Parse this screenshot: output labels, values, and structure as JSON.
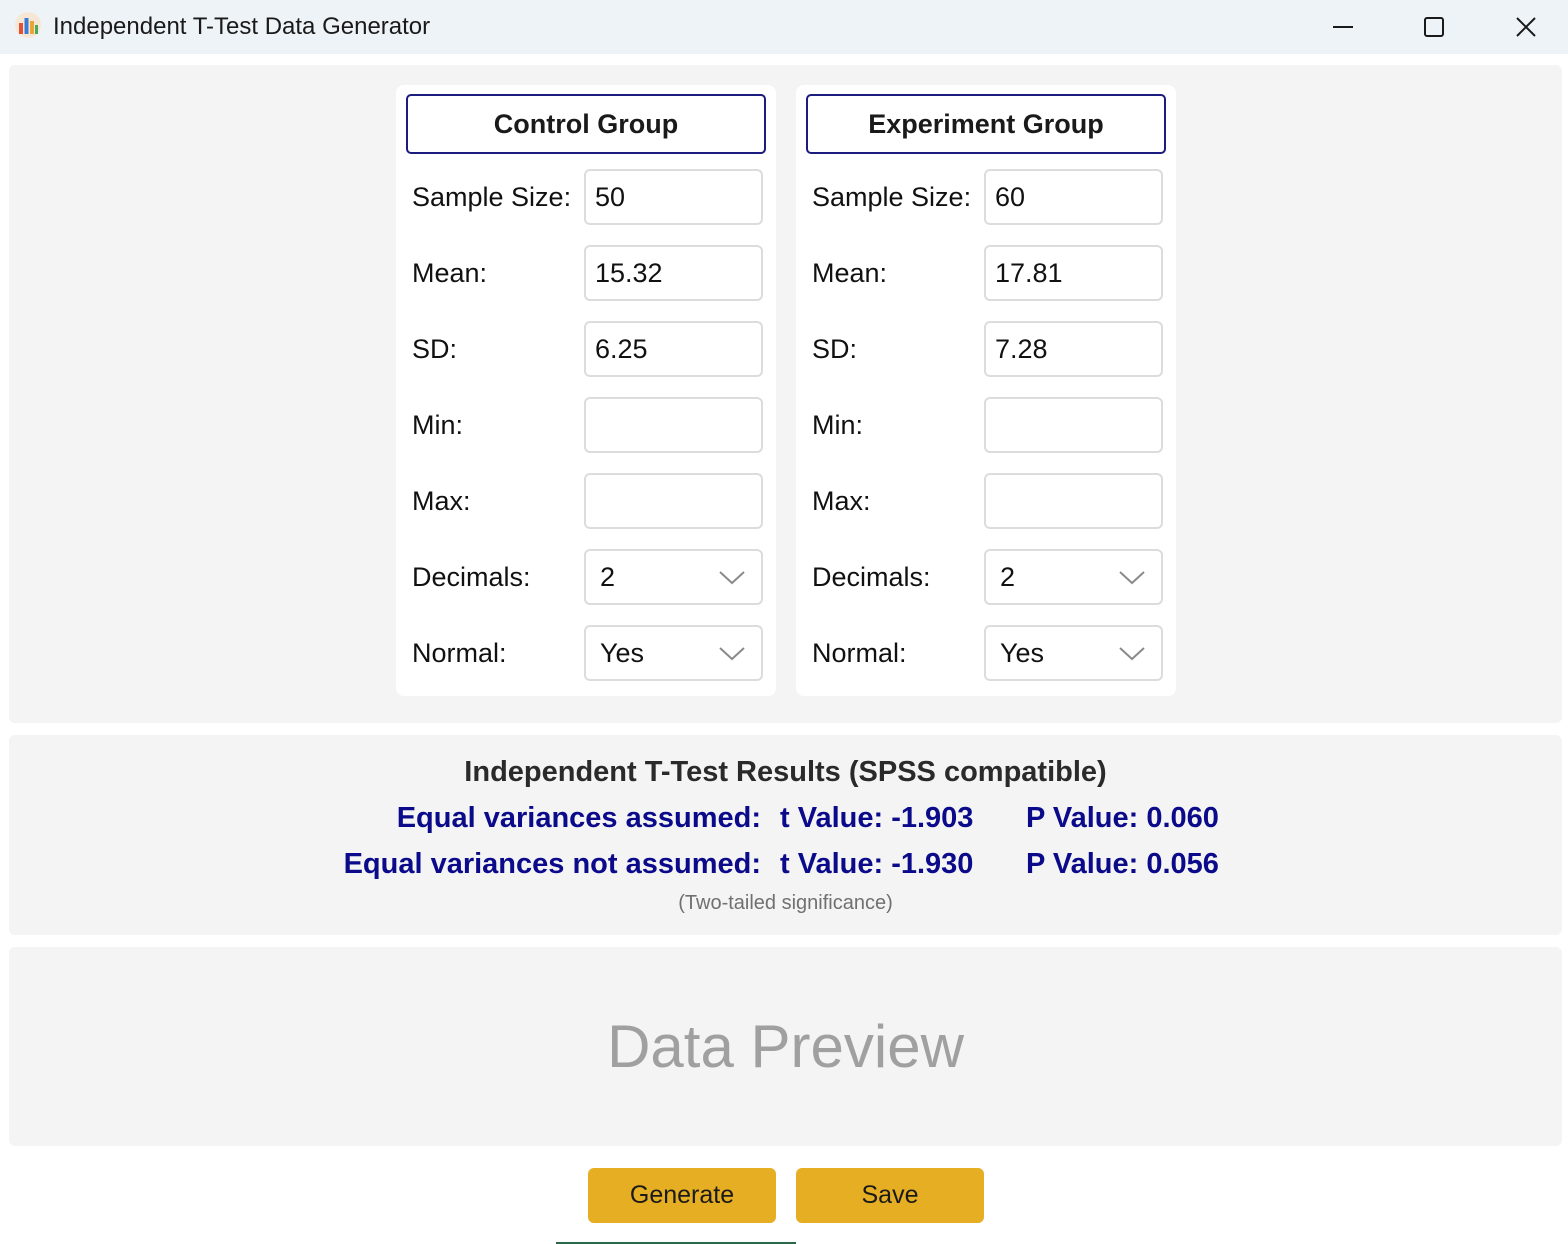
{
  "window": {
    "title": "Independent T-Test Data Generator",
    "icon": "bar-chart-icon",
    "controls": [
      "minimize-icon",
      "maximize-icon",
      "close-icon"
    ]
  },
  "control_group": {
    "header": "Control Group",
    "sample_size_label": "Sample Size:",
    "sample_size": "50",
    "mean_label": "Mean:",
    "mean": "15.32",
    "sd_label": "SD:",
    "sd": "6.25",
    "min_label": "Min:",
    "min": "",
    "max_label": "Max:",
    "max": "",
    "decimals_label": "Decimals:",
    "decimals": "2",
    "normal_label": "Normal:",
    "normal": "Yes"
  },
  "experiment_group": {
    "header": "Experiment Group",
    "sample_size_label": "Sample Size:",
    "sample_size": "60",
    "mean_label": "Mean:",
    "mean": "17.81",
    "sd_label": "SD:",
    "sd": "7.28",
    "min_label": "Min:",
    "min": "",
    "max_label": "Max:",
    "max": "",
    "decimals_label": "Decimals:",
    "decimals": "2",
    "normal_label": "Normal:",
    "normal": "Yes"
  },
  "results": {
    "title": "Independent T-Test Results (SPSS compatible)",
    "rows": [
      {
        "label": "Equal variances assumed:",
        "t": "t Value: -1.903",
        "p": "P Value: 0.060"
      },
      {
        "label": "Equal variances not assumed:",
        "t": "t Value: -1.930",
        "p": "P Value: 0.056"
      }
    ],
    "note": "(Two-tailed significance)"
  },
  "preview": {
    "placeholder": "Data Preview"
  },
  "actions": {
    "generate_label": "Generate",
    "save_label": "Save"
  },
  "colors": {
    "accent_button": "#e6ae22",
    "results_text": "#0a0a8a",
    "header_border": "#1c1c80"
  }
}
